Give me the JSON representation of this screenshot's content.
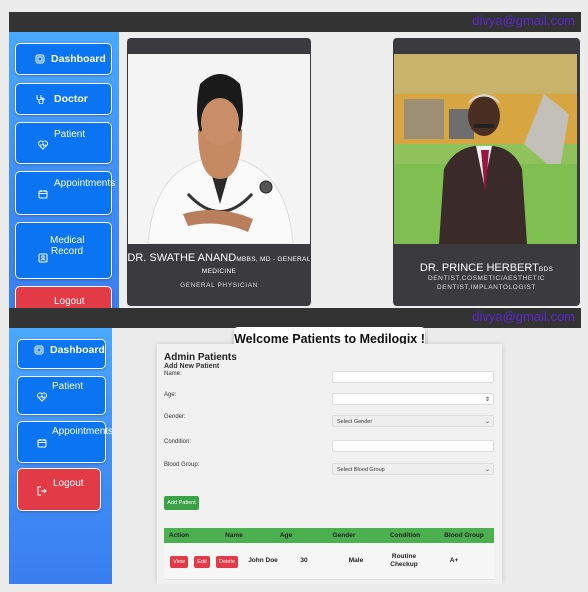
{
  "user": {
    "email": "divya@gmail.com"
  },
  "screen1": {
    "sidebar": [
      {
        "label": "Dashboard",
        "icon": "dashboard-icon"
      },
      {
        "label": "Doctor",
        "icon": "stethoscope-icon"
      },
      {
        "label": "Patient",
        "icon": "heart-pulse-icon"
      },
      {
        "label": "Appointments",
        "icon": "calendar-icon"
      },
      {
        "label": "Medical Record",
        "icon": "id-card-icon"
      },
      {
        "label": "Logout",
        "icon": "logout-icon"
      }
    ],
    "doctors": [
      {
        "name": "DR. SWATHE ANAND",
        "degree": "MBBS, MD - GENERAL MEDICINE",
        "specialty": "GENERAL PHYSICIAN"
      },
      {
        "name": "DR. PRINCE HERBERT",
        "degree": "BDS",
        "specialty_line1": "DENTIST,COSMETIC/AESTHETIC",
        "specialty_line2": "DENTIST,IMPLANTOLOGIST"
      }
    ]
  },
  "screen2": {
    "sidebar": [
      {
        "label": "Dashboard",
        "icon": "dashboard-icon"
      },
      {
        "label": "Patient",
        "icon": "heart-pulse-icon"
      },
      {
        "label": "Appointments",
        "icon": "calendar-icon"
      },
      {
        "label": "Logout",
        "icon": "logout-icon"
      }
    ],
    "welcome": "Welcome Patients to Medilogix !",
    "panel": {
      "title": "Admin Patients",
      "subtitle": "Add New Patient",
      "fields": [
        {
          "label": "Name:",
          "value": ""
        },
        {
          "label": "Age:",
          "value": ""
        },
        {
          "label": "Gender:",
          "value": "Select Gender"
        },
        {
          "label": "Condition:",
          "value": ""
        },
        {
          "label": "Blood Group:",
          "value": "Select Blood Group"
        }
      ],
      "add_button": "Add Patient",
      "table": {
        "headers": [
          "Action",
          "Name",
          "Age",
          "Gender",
          "Condition",
          "Blood Group"
        ],
        "rows": [
          {
            "actions": [
              "View",
              "Edit",
              "Delete"
            ],
            "name": "John Doe",
            "age": "30",
            "gender": "Male",
            "condition_line1": "Routine",
            "condition_line2": "Checkup",
            "blood_group": "A+"
          }
        ]
      }
    }
  }
}
